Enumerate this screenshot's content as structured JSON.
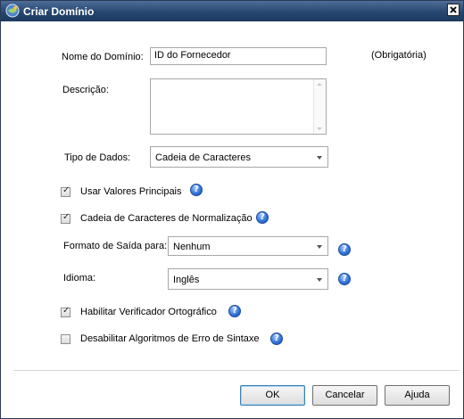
{
  "window": {
    "title": "Criar Domínio",
    "app_icon": "globe-icon",
    "close_icon": "close-icon"
  },
  "form": {
    "domain_name": {
      "label": "Nome do Domínio:",
      "value": "ID do Fornecedor",
      "required_note": "(Obrigatória)"
    },
    "description": {
      "label": "Descrição:",
      "value": ""
    },
    "data_type": {
      "label": "Tipo de Dados:",
      "value": "Cadeia de Caracteres"
    },
    "use_key_values": {
      "label": "Usar Valores Principais",
      "checked": true
    },
    "normalize_strings": {
      "label": "Cadeia de Caracteres de Normalização",
      "checked": true
    },
    "output_format": {
      "label": "Formato de Saída para:",
      "value": "Nenhum"
    },
    "language": {
      "label": "Idioma:",
      "value": "Inglês"
    },
    "spell_checker": {
      "label": "Habilitar Verificador Ortográfico",
      "checked": true
    },
    "syntax_error_algorithms": {
      "label": "Desabilitar Algoritmos de Erro de Sintaxe",
      "checked": false
    }
  },
  "buttons": {
    "ok": "OK",
    "cancel": "Cancelar",
    "help": "Ajuda"
  },
  "help_icon": "question-mark-icon",
  "colors": {
    "titlebar": "#27466f",
    "help_icon": "#2f6fd6",
    "default_button_border": "#3c7fb1"
  }
}
